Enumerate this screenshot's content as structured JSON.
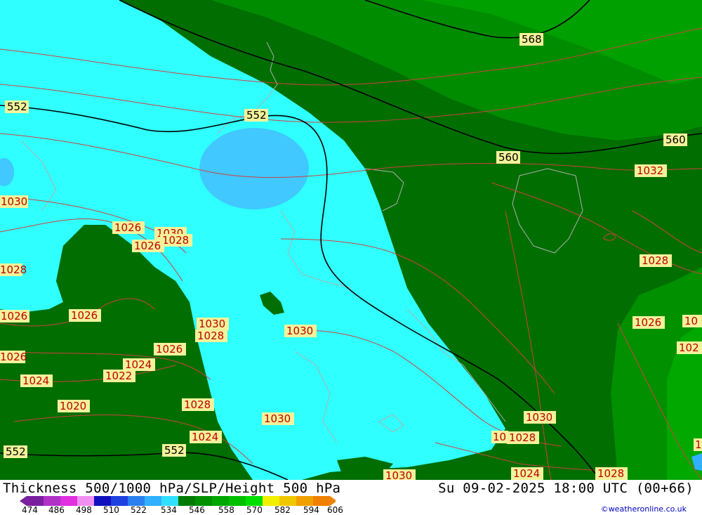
{
  "footer": {
    "title": "Thickness 500/1000 hPa/SLP/Height 500 hPa",
    "time": "Su 09-02-2025 18:00 UTC (00+66)",
    "credit": "©weatheronline.co.uk"
  },
  "legend": {
    "ticks": [
      "474",
      "486",
      "498",
      "510",
      "522",
      "534",
      "546",
      "558",
      "570",
      "582",
      "594",
      "606"
    ],
    "colors": [
      "#7a1fa0",
      "#b030c8",
      "#e030e0",
      "#f090f0",
      "#1010c0",
      "#2040e0",
      "#2a80f0",
      "#30b0ff",
      "#30e0ff",
      "#007a00",
      "#009000",
      "#00a800",
      "#00c000",
      "#00e000",
      "#f0f000",
      "#f0c800",
      "#f0a000",
      "#f08000"
    ]
  },
  "colors": {
    "cyan": "#30ffff",
    "light_blue": "#40c8ff",
    "dark_green": "#006e00",
    "mid_green": "#008c00",
    "bright_green": "#00a000",
    "slp_isobar": "#d04040",
    "coast": "#a0a0a0",
    "height_contour": "#000000"
  },
  "height_labels": [
    "552",
    "552",
    "568",
    "560",
    "560",
    "552",
    "552"
  ],
  "slp_labels": [
    "1030",
    "1026",
    "1030",
    "1028",
    "1026",
    "1028",
    "1026",
    "1026",
    "1030",
    "1028",
    "1026",
    "1026",
    "1024",
    "1022",
    "1024",
    "1020",
    "1028",
    "1030",
    "1024",
    "1030",
    "1030",
    "1030",
    "10",
    "1028",
    "1024",
    "1028",
    "1032",
    "1028",
    "1026",
    "10",
    "102",
    "1"
  ]
}
